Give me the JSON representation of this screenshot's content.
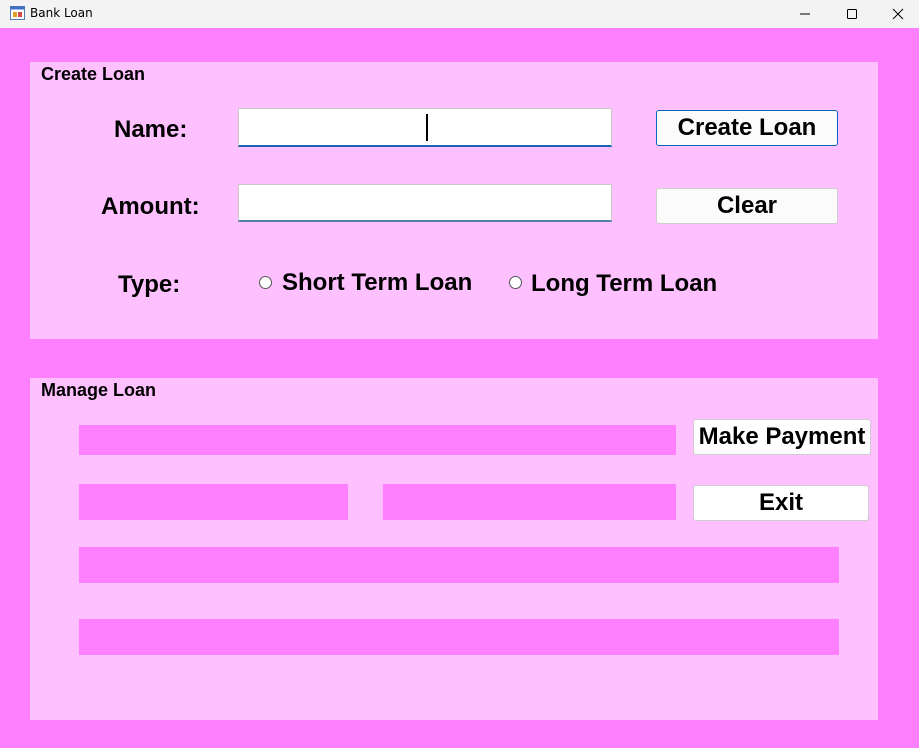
{
  "window": {
    "title": "Bank Loan"
  },
  "create_group": {
    "title": "Create Loan",
    "name_label": "Name:",
    "name_value": "",
    "amount_label": "Amount:",
    "amount_value": "",
    "type_label": "Type:",
    "type_options": [
      "Short Term Loan",
      "Long Term Loan"
    ],
    "create_button": "Create Loan",
    "clear_button": "Clear"
  },
  "manage_group": {
    "title": "Manage Loan",
    "payment_button": "Make Payment",
    "exit_button": "Exit"
  },
  "colors": {
    "form_background": "#ff80ff",
    "group_background": "#ffc0ff",
    "label_background": "#ff80ff"
  },
  "icons": {
    "app": "form-icon",
    "minimize": "minimize-icon",
    "maximize": "maximize-icon",
    "close": "close-icon"
  }
}
